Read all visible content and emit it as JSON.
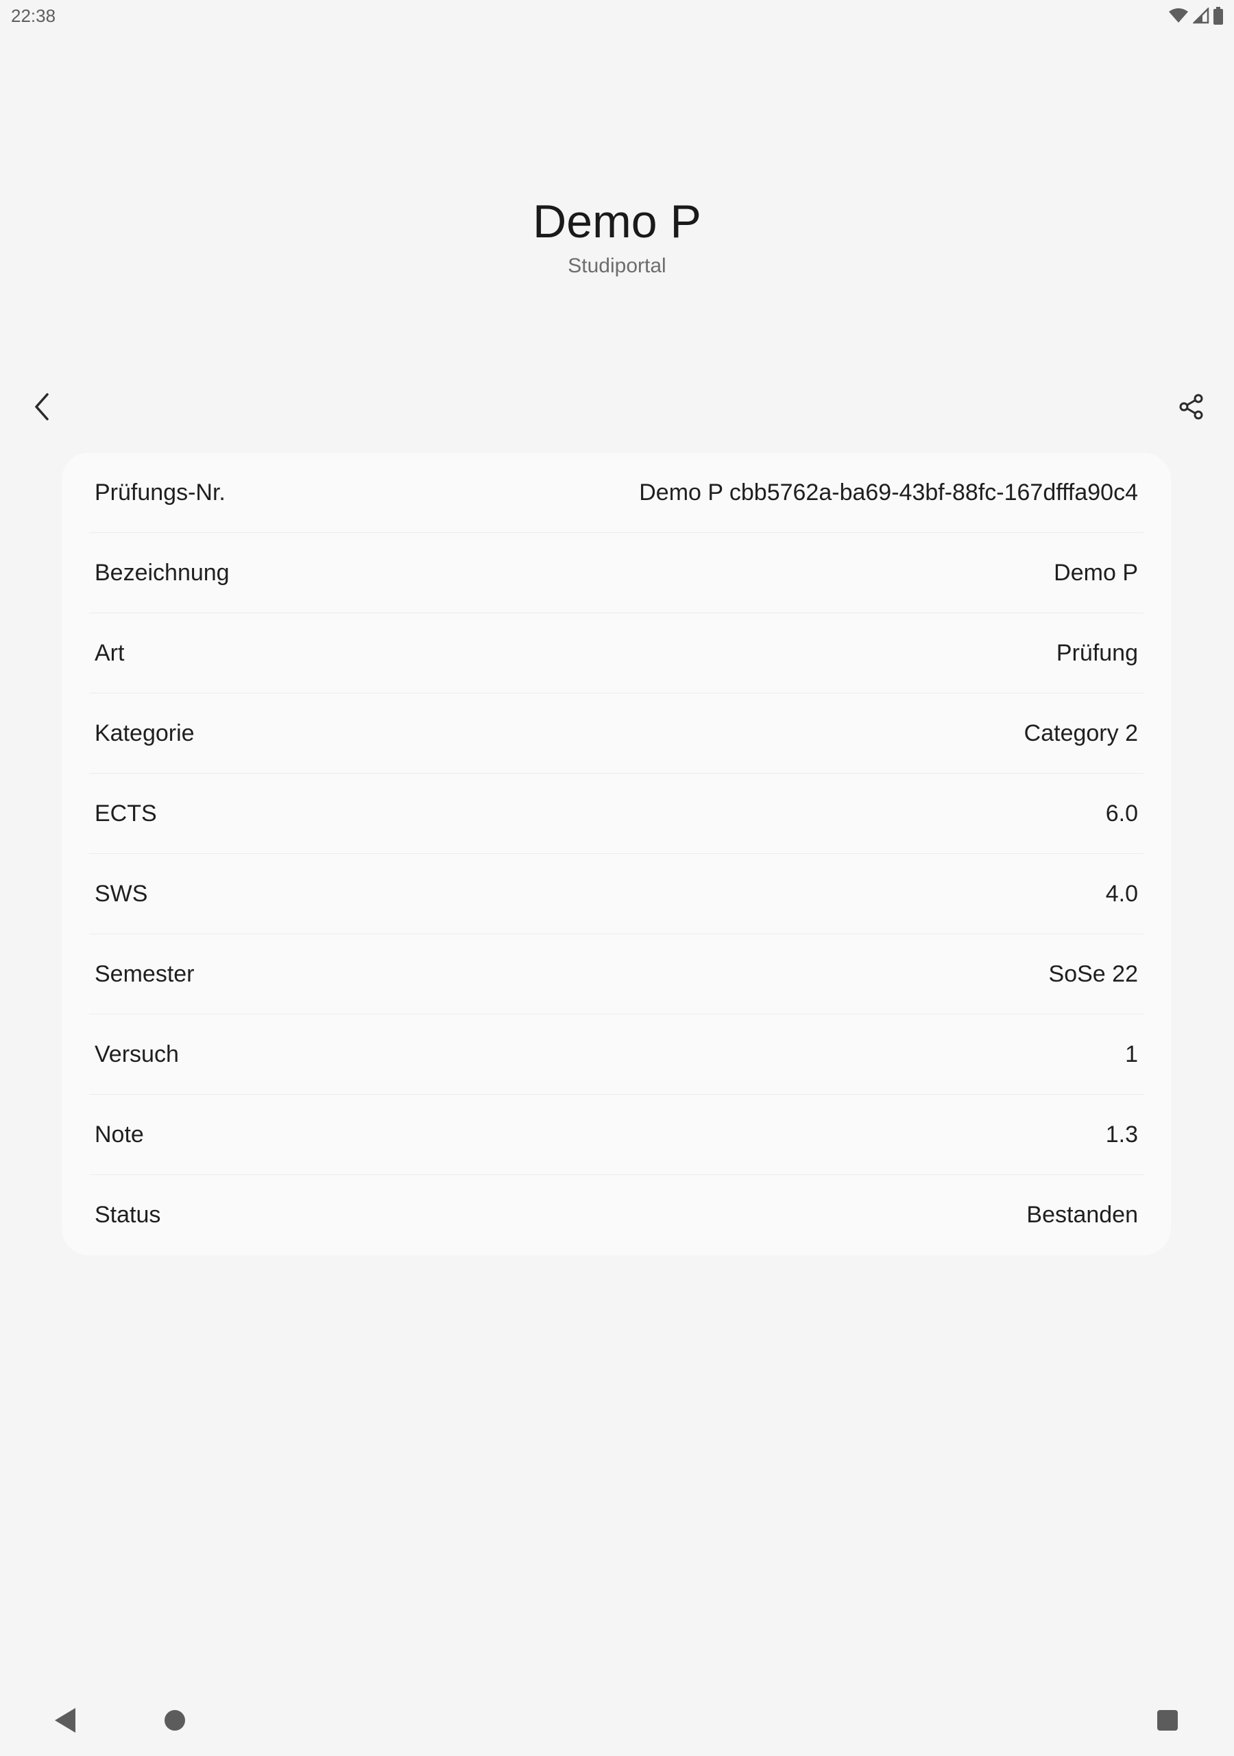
{
  "status_bar": {
    "time": "22:38",
    "icons": [
      "wifi-icon",
      "cellular-signal-icon",
      "battery-icon"
    ]
  },
  "header": {
    "title": "Demo P",
    "subtitle": "Studiportal"
  },
  "toolbar": {
    "back_icon": "chevron-left-icon",
    "share_icon": "share-icon"
  },
  "details": {
    "rows": [
      {
        "label": "Prüfungs-Nr.",
        "value": "Demo P cbb5762a-ba69-43bf-88fc-167dfffa90c4"
      },
      {
        "label": "Bezeichnung",
        "value": "Demo P"
      },
      {
        "label": "Art",
        "value": "Prüfung"
      },
      {
        "label": "Kategorie",
        "value": "Category 2"
      },
      {
        "label": "ECTS",
        "value": "6.0"
      },
      {
        "label": "SWS",
        "value": "4.0"
      },
      {
        "label": "Semester",
        "value": "SoSe 22"
      },
      {
        "label": "Versuch",
        "value": "1"
      },
      {
        "label": "Note",
        "value": "1.3"
      },
      {
        "label": "Status",
        "value": "Bestanden"
      }
    ]
  },
  "nav_bar": {
    "icons": [
      "nav-back-icon",
      "nav-home-icon",
      "nav-recents-icon"
    ]
  },
  "colors": {
    "background": "#f5f5f5",
    "card": "#fafafa",
    "divider": "#ececec",
    "text": "#1f1f1f",
    "subtitle": "#6d6d6d"
  }
}
